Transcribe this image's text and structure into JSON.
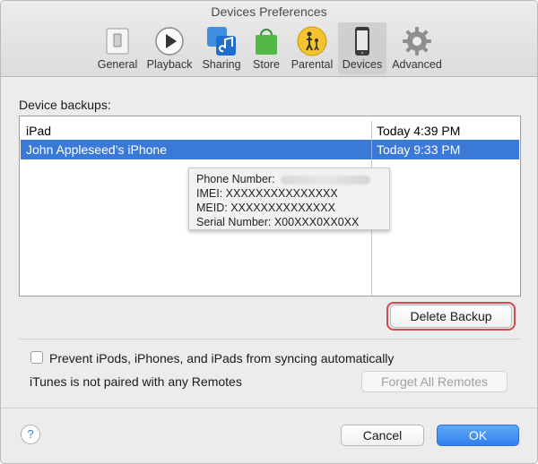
{
  "window": {
    "title": "Devices Preferences"
  },
  "toolbar": {
    "items": [
      {
        "label": "General",
        "icon": "switch-icon"
      },
      {
        "label": "Playback",
        "icon": "play-icon"
      },
      {
        "label": "Sharing",
        "icon": "music-note-icon"
      },
      {
        "label": "Store",
        "icon": "shopping-bag-icon"
      },
      {
        "label": "Parental",
        "icon": "parental-icon"
      },
      {
        "label": "Devices",
        "icon": "iphone-icon",
        "selected": true
      },
      {
        "label": "Advanced",
        "icon": "gear-icon"
      }
    ]
  },
  "backups": {
    "section_label": "Device backups:",
    "rows": [
      {
        "name": "iPad",
        "date": "Today 4:39 PM",
        "selected": false
      },
      {
        "name": "John Appleseed’s iPhone",
        "date": "Today 9:33 PM",
        "selected": true
      }
    ]
  },
  "tooltip": {
    "phone_label": "Phone Number:",
    "imei": "IMEI: XXXXXXXXXXXXXXX",
    "meid": "MEID: XXXXXXXXXXXXXX",
    "serial": "Serial Number: X00XXX0XX0XX"
  },
  "buttons": {
    "delete_backup": "Delete Backup",
    "forget_remotes": "Forget All Remotes",
    "cancel": "Cancel",
    "ok": "OK",
    "help": "?"
  },
  "options": {
    "prevent_sync_label": "Prevent iPods, iPhones, and iPads from syncing automatically",
    "prevent_sync_checked": false,
    "remotes_status": "iTunes is not paired with any Remotes"
  },
  "colors": {
    "selection": "#3a79d5",
    "highlight_ring": "#d2494f",
    "ok_button": "#2f80ed"
  }
}
